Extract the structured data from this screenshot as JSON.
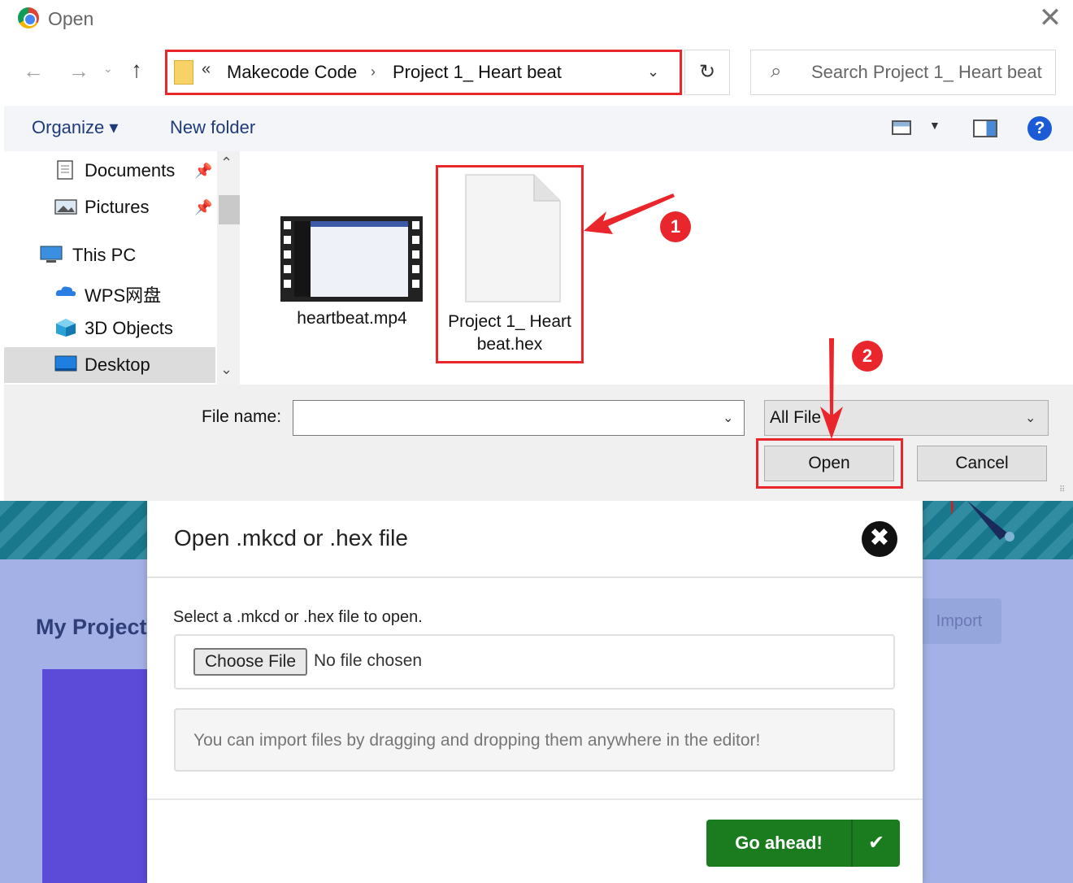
{
  "dialog": {
    "title": "Open",
    "close_glyph": "✕",
    "nav": {
      "back": "←",
      "forward": "→",
      "recent": "⌄",
      "up": "↑"
    },
    "address": {
      "chevrons": "«",
      "segments": [
        "Makecode Code",
        "Project 1_ Heart beat"
      ],
      "separator": "›",
      "dropdown": "⌄"
    },
    "refresh": "↻",
    "search": {
      "icon": "⌕",
      "placeholder": "Search Project 1_ Heart beat"
    },
    "toolbar": {
      "organize": "Organize ▾",
      "new_folder": "New folder",
      "view_dropdown": "▼",
      "help": "?"
    },
    "nav_pane": [
      {
        "label": "Documents",
        "icon": "documents-icon",
        "pinned": true
      },
      {
        "label": "Pictures",
        "icon": "pictures-icon",
        "pinned": true
      },
      {
        "label": "This PC",
        "icon": "this-pc-icon",
        "pinned": false
      },
      {
        "label": "WPS网盘",
        "icon": "cloud-icon",
        "pinned": false
      },
      {
        "label": "3D Objects",
        "icon": "3d-objects-icon",
        "pinned": false
      },
      {
        "label": "Desktop",
        "icon": "desktop-icon",
        "pinned": false,
        "selected": true
      }
    ],
    "files": [
      {
        "name": "heartbeat.mp4",
        "icon": "video-file-icon"
      },
      {
        "name_line1": "Project 1_ Heart",
        "name_line2": "beat.hex",
        "icon": "blank-file-icon"
      }
    ],
    "file_name_label": "File name:",
    "file_name_value": "",
    "file_type": "All File",
    "open_button": "Open",
    "cancel_button": "Cancel",
    "dropdown_glyph": "⌄"
  },
  "annotations": {
    "badge1": "1",
    "badge2": "2",
    "color": "#e8262b"
  },
  "background_page": {
    "section_title": "My Projects",
    "import_button": "Import"
  },
  "modal": {
    "title": "Open .mkcd or .hex file",
    "close_glyph": "✖",
    "description": "Select a .mkcd or .hex file to open.",
    "choose_file": "Choose File",
    "no_file": "No file chosen",
    "hint": "You can import files by dragging and dropping them anywhere in the editor!",
    "go_button": "Go ahead!",
    "go_check": "✔",
    "accent_color": "#1b7b1f"
  }
}
